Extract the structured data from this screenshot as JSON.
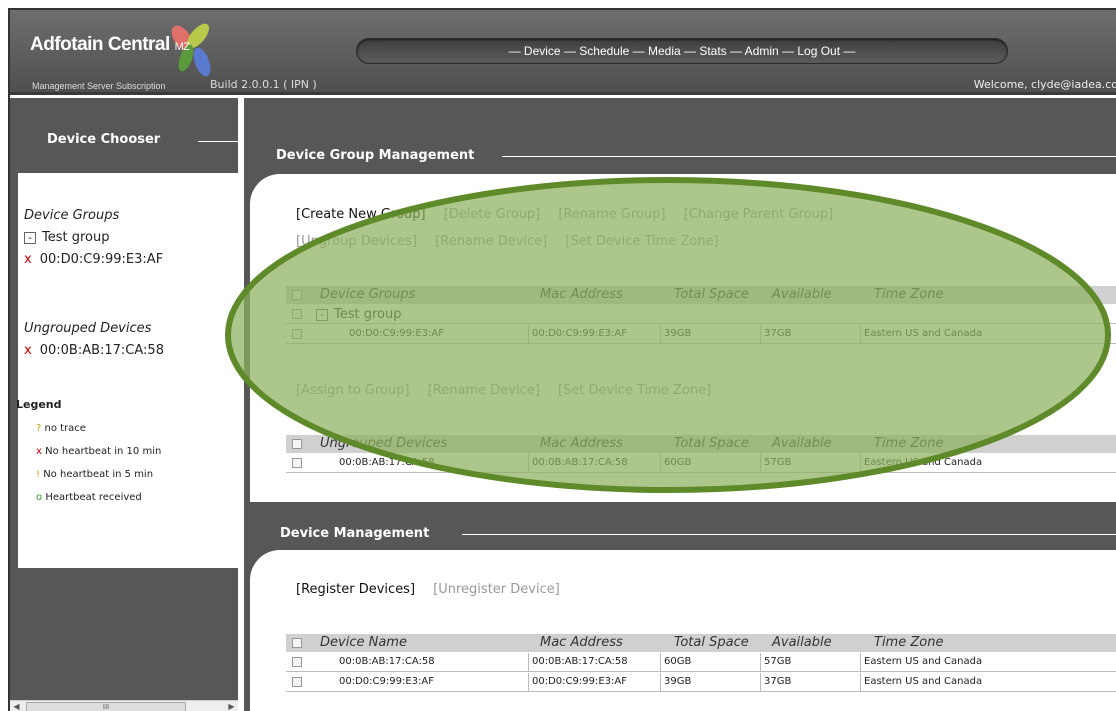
{
  "header": {
    "logo_main": "Adfotain Central",
    "logo_suffix": "MZ",
    "logo_sub": "Management Server Subscription",
    "build": "Build 2.0.0.1 ( IPN )",
    "nav": "— Device — Schedule — Media — Stats — Admin — Log Out —",
    "welcome": "Welcome, clyde@iadea.co"
  },
  "sidebar": {
    "title": "Device Chooser",
    "groups_heading": "Device Groups",
    "group_minus": "-",
    "group_name": "Test group",
    "group_device_status": "x",
    "group_device": "00:D0:C9:99:E3:AF",
    "ungrouped_heading": "Ungrouped Devices",
    "ungrouped_status": "x",
    "ungrouped_device": "00:0B:AB:17:CA:58",
    "legend_title": "Legend",
    "legend": [
      {
        "symbol": "?",
        "text": "no trace",
        "color": "#c8a000"
      },
      {
        "symbol": "x",
        "text": "No heartbeat in 10 min",
        "color": "#cc0000"
      },
      {
        "symbol": "!",
        "text": "No heartbeat in 5 min",
        "color": "#e0a000"
      },
      {
        "symbol": "o",
        "text": "Heartbeat received",
        "color": "#2a9a2a"
      }
    ],
    "scroll_thumb": "III"
  },
  "group_mgmt": {
    "title": "Device Group Management",
    "actions_row1": [
      "[Create New Group]",
      "[Delete Group]",
      "[Rename Group]",
      "[Change Parent Group]"
    ],
    "actions_row2": [
      "[Ungroup Devices]",
      "[Rename Device]",
      "[Set Device Time Zone]"
    ],
    "table_headers": [
      "Device Groups",
      "Mac Address",
      "Total Space",
      "Available",
      "Time Zone"
    ],
    "group_row": {
      "minus": "-",
      "name": "Test group"
    },
    "group_device_row": [
      "00:D0:C9:99:E3:AF",
      "00:D0:C9:99:E3:AF",
      "39GB",
      "37GB",
      "Eastern US and Canada"
    ],
    "actions_row3": [
      "[Assign to Group]",
      "[Rename Device]",
      "[Set Device Time Zone]"
    ],
    "ungrouped_headers": [
      "Ungrouped Devices",
      "Mac Address",
      "Total Space",
      "Available",
      "Time Zone"
    ],
    "ungrouped_row": [
      "00:0B:AB:17:CA:58",
      "00:0B:AB:17:CA:58",
      "60GB",
      "57GB",
      "Eastern US and Canada"
    ]
  },
  "device_mgmt": {
    "title": "Device Management",
    "actions": [
      "[Register Devices]",
      "[Unregister Device]"
    ],
    "table_headers": [
      "Device Name",
      "Mac Address",
      "Total Space",
      "Available",
      "Time Zone"
    ],
    "rows": [
      [
        "00:0B:AB:17:CA:58",
        "00:0B:AB:17:CA:58",
        "60GB",
        "57GB",
        "Eastern US and Canada"
      ],
      [
        "00:D0:C9:99:E3:AF",
        "00:D0:C9:99:E3:AF",
        "39GB",
        "37GB",
        "Eastern US and Canada"
      ]
    ]
  },
  "colors": {
    "highlight_fill": "#8db060",
    "highlight_stroke": "#5f8a2a",
    "bar": "#575757"
  }
}
